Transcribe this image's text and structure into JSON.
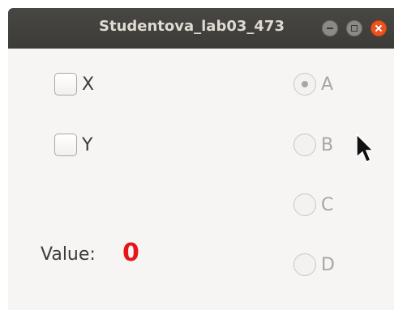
{
  "window": {
    "title": "Studentova_lab03_473"
  },
  "checkboxes": [
    {
      "label": "X",
      "checked": false
    },
    {
      "label": "Y",
      "checked": false
    }
  ],
  "radios": [
    {
      "label": "A",
      "selected": true,
      "enabled": false
    },
    {
      "label": "B",
      "selected": false,
      "enabled": false
    },
    {
      "label": "C",
      "selected": false,
      "enabled": false
    },
    {
      "label": "D",
      "selected": false,
      "enabled": false
    }
  ],
  "value": {
    "label": "Value:",
    "number": "0"
  },
  "colors": {
    "titlebar": "#3c3b37",
    "close_button": "#e95420",
    "value_number": "#e8141b",
    "window_bg": "#f6f5f4"
  },
  "icons": {
    "minimize": "minimize-icon",
    "maximize": "maximize-icon",
    "close": "close-icon",
    "cursor": "mouse-pointer-icon"
  }
}
